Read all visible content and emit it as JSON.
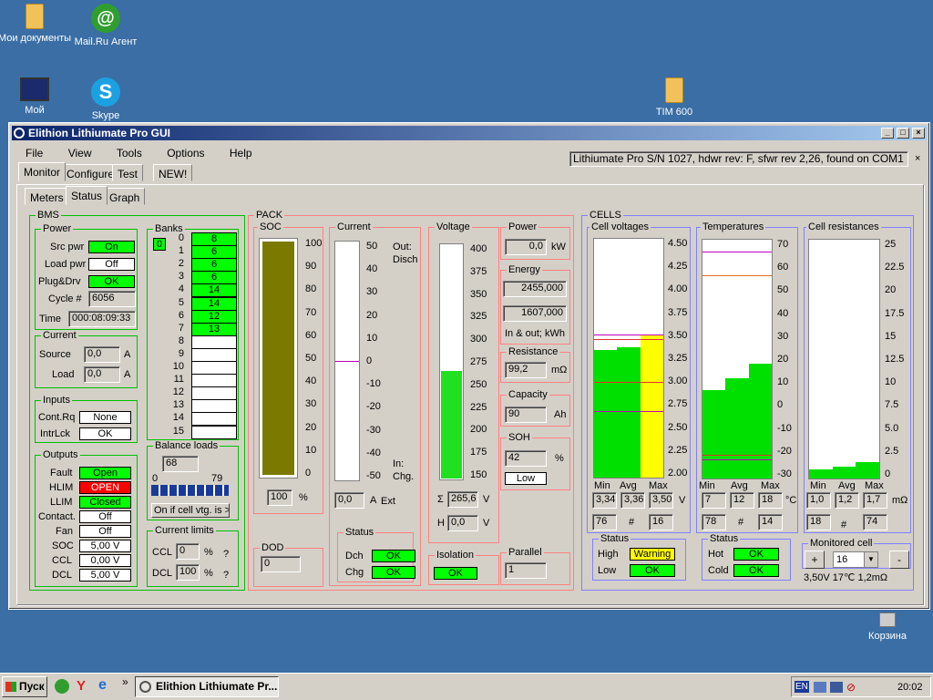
{
  "desktop": {
    "icons": [
      {
        "label": "Мои документы",
        "icon": "my-documents-icon"
      },
      {
        "label": "Mail.Ru Агент",
        "icon": "mailru-agent-icon"
      },
      {
        "label": "Мой",
        "icon": "my-computer-icon"
      },
      {
        "label": "Skype",
        "icon": "skype-icon"
      },
      {
        "label": "TIM 600",
        "icon": "folder-icon"
      },
      {
        "label": "Корзина",
        "icon": "recycle-bin-icon"
      }
    ]
  },
  "window": {
    "title": "Elithion Lithiumate Pro GUI"
  },
  "menu": {
    "file": "File",
    "view": "View",
    "tools": "Tools",
    "options": "Options",
    "help": "Help"
  },
  "status_line": "Lithiumate Pro S/N 1027, hdwr rev: F, sfwr rev 2,26, found on COM1",
  "tabs": {
    "monitor": "Monitor",
    "configure": "Configure",
    "test": "Test",
    "new": "NEW!"
  },
  "subtabs": {
    "meters": "Meters",
    "status": "Status",
    "graph": "Graph"
  },
  "bms": {
    "title": "BMS",
    "power": {
      "title": "Power",
      "src_label": "Src pwr",
      "src_value": "On",
      "load_label": "Load pwr",
      "load_value": "Off",
      "plug_label": "Plug&Drv",
      "plug_value": "OK",
      "cycle_label": "Cycle #",
      "cycle_value": "6056",
      "time_label": "Time",
      "time_value": "000:08:09:33"
    },
    "current": {
      "title": "Current",
      "source_label": "Source",
      "source_value": "0,0",
      "source_unit": "A",
      "load_label": "Load",
      "load_value": "0,0",
      "load_unit": "A"
    },
    "inputs": {
      "title": "Inputs",
      "contrq_label": "Cont.Rq",
      "contrq_value": "None",
      "intrlck_label": "IntrLck",
      "intrlck_value": "OK"
    },
    "outputs": {
      "title": "Outputs",
      "fault_label": "Fault",
      "fault_value": "Open",
      "hlim_label": "HLIM",
      "hlim_value": "OPEN",
      "llim_label": "LLIM",
      "llim_value": "Closed",
      "contact_label": "Contact.",
      "contact_value": "Off",
      "fan_label": "Fan",
      "fan_value": "Off",
      "soc_label": "SOC",
      "soc_value": "5,00 V",
      "ccl_label": "CCL",
      "ccl_value": "0,00 V",
      "dcl_label": "DCL",
      "dcl_value": "5,00 V"
    },
    "banks": {
      "title": "Banks",
      "selected": "0",
      "rows": [
        {
          "id": "0",
          "value": "8"
        },
        {
          "id": "1",
          "value": "6"
        },
        {
          "id": "2",
          "value": "6"
        },
        {
          "id": "3",
          "value": "6"
        },
        {
          "id": "4",
          "value": "14"
        },
        {
          "id": "5",
          "value": "14"
        },
        {
          "id": "6",
          "value": "12"
        },
        {
          "id": "7",
          "value": "13"
        },
        {
          "id": "8",
          "value": ""
        },
        {
          "id": "9",
          "value": ""
        },
        {
          "id": "10",
          "value": ""
        },
        {
          "id": "11",
          "value": ""
        },
        {
          "id": "12",
          "value": ""
        },
        {
          "id": "13",
          "value": ""
        },
        {
          "id": "14",
          "value": ""
        },
        {
          "id": "15",
          "value": ""
        }
      ]
    },
    "balance": {
      "title": "Balance loads",
      "value": "68",
      "min": "0",
      "max": "79",
      "mode": "On if cell vtg. is >"
    },
    "current_limits": {
      "title": "Current limits",
      "ccl_label": "CCL",
      "ccl_value": "0",
      "ccl_unit": "%",
      "dcl_label": "DCL",
      "dcl_value": "100",
      "dcl_unit": "%",
      "help": "?"
    }
  },
  "pack": {
    "title": "PACK",
    "soc": {
      "title": "SOC",
      "value": "100",
      "unit": "%",
      "level": 1.0,
      "ticks": [
        "100",
        "90",
        "80",
        "70",
        "60",
        "50",
        "40",
        "30",
        "20",
        "10",
        "0"
      ]
    },
    "dod": {
      "title": "DOD",
      "value": "0"
    },
    "current": {
      "title": "Current",
      "out_label": "Out:\nDisch",
      "in_label": "In:\nChg.",
      "value": "0,0",
      "unit": "A",
      "ext": "Ext",
      "ticks": [
        "50",
        "40",
        "30",
        "20",
        "10",
        "0",
        "-10",
        "-20",
        "-30",
        "-40",
        "-50"
      ],
      "reading": 0.0
    },
    "status": {
      "title": "Status",
      "dch_label": "Dch",
      "dch_value": "OK",
      "chg_label": "Chg",
      "chg_value": "OK"
    },
    "voltage": {
      "title": "Voltage",
      "ticks": [
        "400",
        "375",
        "350",
        "325",
        "300",
        "275",
        "250",
        "225",
        "200",
        "175",
        "150"
      ],
      "level": 265.6,
      "sum_symbol": "Σ",
      "sum_value": "265,6",
      "sum_unit": "V",
      "h_label": "H",
      "h_value": "0,0",
      "h_unit": "V"
    },
    "isolation": {
      "title": "Isolation",
      "value": "OK"
    },
    "power": {
      "title": "Power",
      "value": "0,0",
      "unit": "kW"
    },
    "energy": {
      "title": "Energy",
      "out_value": "2455,000",
      "in_value": "1607,000",
      "note": "In & out; kWh"
    },
    "resistance": {
      "title": "Resistance",
      "value": "99,2",
      "unit": "mΩ"
    },
    "capacity": {
      "title": "Capacity",
      "value": "90",
      "unit": "Ah"
    },
    "soh": {
      "title": "SOH",
      "value": "42",
      "unit": "%",
      "state": "Low"
    },
    "parallel": {
      "title": "Parallel",
      "value": "1"
    }
  },
  "cells": {
    "title": "CELLS",
    "voltages": {
      "title": "Cell voltages",
      "ticks": [
        "4.50",
        "4.25",
        "4.00",
        "3.75",
        "3.50",
        "3.25",
        "3.00",
        "2.75",
        "2.50",
        "2.25",
        "2.00"
      ],
      "min_label": "Min",
      "avg_label": "Avg",
      "max_label": "Max",
      "min": "3,34",
      "avg": "3,36",
      "max": "3,50",
      "unit": "V",
      "min_cell": "76",
      "hash": "#",
      "max_cell": "16",
      "bars": [
        3.34,
        3.36,
        3.5
      ]
    },
    "voltage_status": {
      "title": "Status",
      "high_label": "High",
      "high_value": "Warning",
      "low_label": "Low",
      "low_value": "OK"
    },
    "temperatures": {
      "title": "Temperatures",
      "ticks": [
        "70",
        "60",
        "50",
        "40",
        "30",
        "20",
        "10",
        "0",
        "-10",
        "-20",
        "-30"
      ],
      "min_label": "Min",
      "avg_label": "Avg",
      "max_label": "Max",
      "min": "7",
      "avg": "12",
      "max": "18",
      "unit": "°C",
      "min_cell": "78",
      "hash": "#",
      "max_cell": "14",
      "bars": [
        7,
        12,
        18
      ]
    },
    "temp_status": {
      "title": "Status",
      "hot_label": "Hot",
      "hot_value": "OK",
      "cold_label": "Cold",
      "cold_value": "OK"
    },
    "resistances": {
      "title": "Cell resistances",
      "ticks": [
        "25",
        "22.5",
        "20",
        "17.5",
        "15",
        "12.5",
        "10",
        "7.5",
        "5.0",
        "2.5",
        "0"
      ],
      "min_label": "Min",
      "avg_label": "Avg",
      "max_label": "Max",
      "min": "1,0",
      "avg": "1,2",
      "max": "1,7",
      "unit": "mΩ",
      "min_cell": "18",
      "hash": "#",
      "max_cell": "74",
      "bars": [
        1.0,
        1.2,
        1.7
      ]
    },
    "monitored": {
      "title": "Monitored cell",
      "plus": "+",
      "value": "16",
      "minus": "-",
      "readout": "3,50V 17℃ 1,2mΩ"
    }
  },
  "taskbar": {
    "start": "Пуск",
    "task": "Elithion Lithiumate Pr...",
    "lang": "EN",
    "clock": "20:02"
  }
}
